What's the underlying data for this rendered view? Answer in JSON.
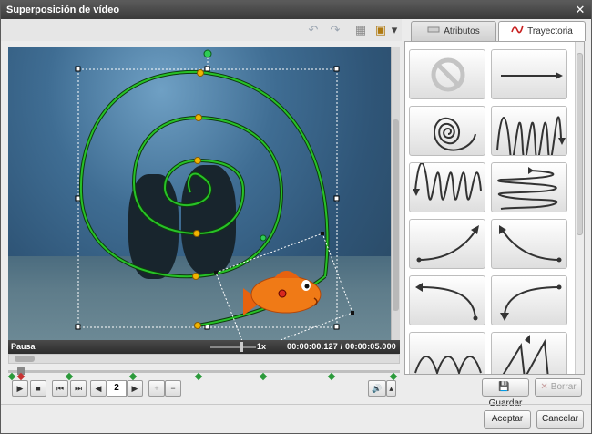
{
  "window": {
    "title": "Superposición de vídeo",
    "close_glyph": "✕"
  },
  "toolbar": {
    "undo_icon": "↶",
    "redo_icon": "↷",
    "grid_icon": "▦",
    "screen_icon": "▣",
    "dropdown_icon": "▾"
  },
  "tabs": [
    {
      "label": "Atributos",
      "icon": "attributes-icon",
      "selected": false
    },
    {
      "label": "Trayectoria",
      "icon": "trajectory-icon",
      "selected": true
    }
  ],
  "status": {
    "state": "Pausa",
    "speed": "1x",
    "time": "00:00:00.127 / 00:00:05.000"
  },
  "controls": {
    "play_glyph": "▶",
    "stop_glyph": "■",
    "first_glyph": "⏮",
    "last_glyph": "⏭",
    "prev_glyph": "◀",
    "next_glyph": "▶",
    "page": "2",
    "add_glyph": "+",
    "remove_glyph": "−",
    "volume_glyph": "🔊",
    "volume_arrow": "▴"
  },
  "trajectories": [
    "no-trajectory",
    "straight-line",
    "spiral",
    "vertical-wave",
    "vertical-wave-down",
    "horizontal-zigzag",
    "curve-up-right",
    "curve-up-left",
    "curve-left-down",
    "curve-right-down",
    "wave-partial",
    "zigzag-partial"
  ],
  "buttons": {
    "save": "Guardar",
    "delete": "Borrar",
    "accept": "Aceptar",
    "cancel": "Cancelar",
    "save_icon": "💾",
    "delete_icon": "✕"
  },
  "colors": {
    "path": "#27c227",
    "point": "#f2b400",
    "fish": "#f07a16",
    "handle": "#111111"
  }
}
